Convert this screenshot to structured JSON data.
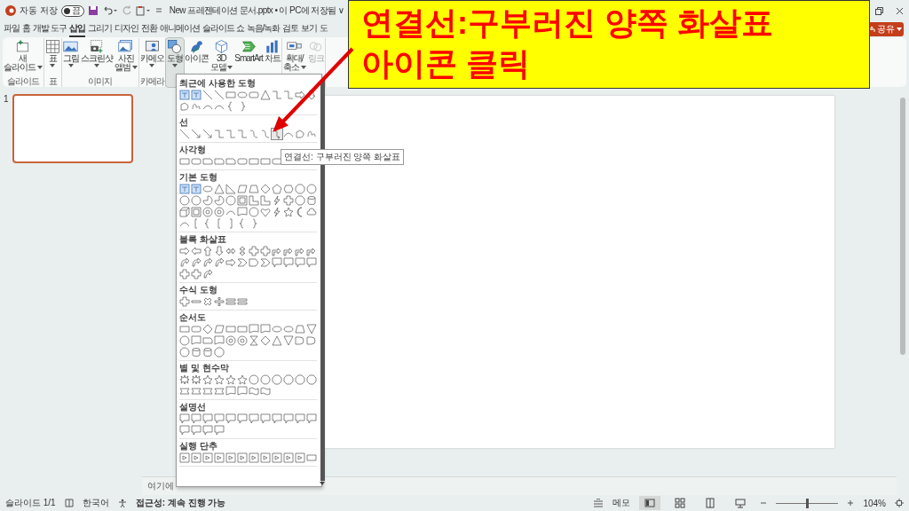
{
  "title_bar": {
    "autosave_label": "자동 저장",
    "autosave": {
      "on": false,
      "text": "끔"
    },
    "document_title": "New 프레젠테이션 문서.pptx • 이 PC에 저장됨 ∨"
  },
  "tabs": [
    {
      "label": "파일",
      "selected": false
    },
    {
      "label": "홈",
      "selected": false
    },
    {
      "label": "개발 도구",
      "selected": false
    },
    {
      "label": "삽입",
      "selected": true
    },
    {
      "label": "그리기",
      "selected": false
    },
    {
      "label": "디자인",
      "selected": false
    },
    {
      "label": "전환",
      "selected": false
    },
    {
      "label": "애니메이션",
      "selected": false
    },
    {
      "label": "슬라이드 쇼",
      "selected": false
    },
    {
      "label": "녹음/녹화",
      "selected": false
    },
    {
      "label": "검토",
      "selected": false
    },
    {
      "label": "보기",
      "selected": false
    },
    {
      "label": "도",
      "selected": false
    }
  ],
  "share_button": "공유",
  "ribbon": {
    "groups": [
      {
        "label": "슬라이드",
        "items": [
          {
            "label": "새\n슬라이드",
            "dropdown": true,
            "selected": false,
            "disabled": false
          }
        ]
      },
      {
        "label": "표",
        "items": [
          {
            "label": "표",
            "dropdown": true,
            "selected": false,
            "disabled": false
          }
        ]
      },
      {
        "label": "이미지",
        "items": [
          {
            "label": "그림",
            "dropdown": true,
            "selected": false,
            "disabled": false
          },
          {
            "label": "스크린샷",
            "dropdown": true,
            "selected": false,
            "disabled": false
          },
          {
            "label": "사진\n앨범",
            "dropdown": true,
            "selected": false,
            "disabled": false
          }
        ]
      },
      {
        "label": "카메라",
        "items": [
          {
            "label": "카메오",
            "dropdown": true,
            "selected": false,
            "disabled": false
          }
        ]
      },
      {
        "items": [
          {
            "label": "도형",
            "dropdown": true,
            "selected": true,
            "disabled": false
          },
          {
            "label": "아이콘",
            "dropdown": false,
            "selected": false,
            "disabled": false
          },
          {
            "label": "3D\n모델",
            "dropdown": true,
            "selected": false,
            "disabled": false
          },
          {
            "label": "SmartArt",
            "dropdown": false,
            "selected": false,
            "disabled": false
          },
          {
            "label": "차트",
            "dropdown": false,
            "selected": false,
            "disabled": false
          }
        ]
      },
      {
        "items": [
          {
            "label": "확대/\n축소",
            "dropdown": true,
            "selected": false,
            "disabled": false
          },
          {
            "label": "링크",
            "dropdown": false,
            "selected": false,
            "disabled": true
          }
        ]
      }
    ]
  },
  "shapes_menu": {
    "sections": [
      {
        "heading": "최근에 사용한 도형",
        "shapes": [
          {
            "kind": "textbox"
          },
          {
            "kind": "textbox"
          },
          {
            "kind": "line"
          },
          {
            "kind": "line"
          },
          {
            "kind": "rect"
          },
          {
            "kind": "oval"
          },
          {
            "kind": "roundrect"
          },
          {
            "kind": "triangle"
          },
          {
            "kind": "elbow"
          },
          {
            "kind": "elbow"
          },
          {
            "kind": "arrow-right"
          },
          {
            "kind": "arrow-down"
          },
          {
            "kind": "freeform"
          },
          {
            "kind": "scribble"
          },
          {
            "kind": "arc"
          },
          {
            "kind": "arc"
          },
          {
            "kind": "brace-left"
          },
          {
            "kind": "brace-right"
          }
        ]
      },
      {
        "heading": "선",
        "shapes": [
          {
            "kind": "line",
            "selected": false
          },
          {
            "kind": "arrow-line",
            "selected": false
          },
          {
            "kind": "arrow-line",
            "selected": false
          },
          {
            "kind": "elbow",
            "selected": false
          },
          {
            "kind": "elbow",
            "selected": false
          },
          {
            "kind": "elbow",
            "selected": false
          },
          {
            "kind": "curve",
            "selected": false
          },
          {
            "kind": "curve",
            "selected": false
          },
          {
            "kind": "curved-double-arrow",
            "selected": true
          },
          {
            "kind": "arc",
            "selected": false
          },
          {
            "kind": "freeform",
            "selected": false
          },
          {
            "kind": "scribble",
            "selected": false
          }
        ]
      },
      {
        "heading": "사각형",
        "shapes": [
          {
            "kind": "rect"
          },
          {
            "kind": "roundrect"
          },
          {
            "kind": "snip"
          },
          {
            "kind": "snip"
          },
          {
            "kind": "snip"
          },
          {
            "kind": "roundrect"
          },
          {
            "kind": "rect"
          },
          {
            "kind": "rect"
          },
          {
            "kind": "roundrect"
          }
        ]
      },
      {
        "heading": "기본 도형",
        "shapes": [
          {
            "kind": "textbox"
          },
          {
            "kind": "textbox"
          },
          {
            "kind": "oval"
          },
          {
            "kind": "triangle"
          },
          {
            "kind": "rtriangle"
          },
          {
            "kind": "parallelogram"
          },
          {
            "kind": "trapezoid"
          },
          {
            "kind": "diamond"
          },
          {
            "kind": "pentagon"
          },
          {
            "kind": "hexagon"
          },
          {
            "kind": "octagon"
          },
          {
            "kind": "circle"
          },
          {
            "kind": "circle"
          },
          {
            "kind": "circle"
          },
          {
            "kind": "pie"
          },
          {
            "kind": "pie"
          },
          {
            "kind": "circle"
          },
          {
            "kind": "frame"
          },
          {
            "kind": "lshape"
          },
          {
            "kind": "lshape"
          },
          {
            "kind": "lightning"
          },
          {
            "kind": "plus"
          },
          {
            "kind": "octagon"
          },
          {
            "kind": "can"
          },
          {
            "kind": "cube"
          },
          {
            "kind": "frame"
          },
          {
            "kind": "donut"
          },
          {
            "kind": "donut"
          },
          {
            "kind": "arc"
          },
          {
            "kind": "document"
          },
          {
            "kind": "circle"
          },
          {
            "kind": "heart"
          },
          {
            "kind": "lightning"
          },
          {
            "kind": "star"
          },
          {
            "kind": "moon"
          },
          {
            "kind": "cloud"
          },
          {
            "kind": "arc"
          },
          {
            "kind": "bracket-left"
          },
          {
            "kind": "brace-left"
          },
          {
            "kind": "bracket-left"
          },
          {
            "kind": "bracket-right"
          },
          {
            "kind": "brace-left"
          },
          {
            "kind": "brace-right"
          }
        ]
      },
      {
        "heading": "블록 화살표",
        "shapes": [
          {
            "kind": "arrow-right"
          },
          {
            "kind": "arrow-left"
          },
          {
            "kind": "arrow-up"
          },
          {
            "kind": "arrow-down"
          },
          {
            "kind": "arrow-lr"
          },
          {
            "kind": "arrow-ud"
          },
          {
            "kind": "plus"
          },
          {
            "kind": "plus"
          },
          {
            "kind": "arrow-bent"
          },
          {
            "kind": "arrow-bent"
          },
          {
            "kind": "arrow-bent"
          },
          {
            "kind": "arrow-bent"
          },
          {
            "kind": "arrow-curved"
          },
          {
            "kind": "arrow-curved"
          },
          {
            "kind": "arrow-curved"
          },
          {
            "kind": "arrow-curved"
          },
          {
            "kind": "arrow-right"
          },
          {
            "kind": "chevron"
          },
          {
            "kind": "pentagon-arrow"
          },
          {
            "kind": "chevron"
          },
          {
            "kind": "callout"
          },
          {
            "kind": "callout"
          },
          {
            "kind": "callout"
          },
          {
            "kind": "callout"
          },
          {
            "kind": "plus"
          },
          {
            "kind": "plus"
          },
          {
            "kind": "arrow-curved"
          }
        ]
      },
      {
        "heading": "수식 도형",
        "shapes": [
          {
            "kind": "plus"
          },
          {
            "kind": "minus"
          },
          {
            "kind": "times"
          },
          {
            "kind": "divide"
          },
          {
            "kind": "equal"
          },
          {
            "kind": "equal"
          }
        ]
      },
      {
        "heading": "순서도",
        "shapes": [
          {
            "kind": "rect"
          },
          {
            "kind": "roundrect"
          },
          {
            "kind": "diamond"
          },
          {
            "kind": "parallelogram"
          },
          {
            "kind": "rect"
          },
          {
            "kind": "rect"
          },
          {
            "kind": "document"
          },
          {
            "kind": "document"
          },
          {
            "kind": "oval"
          },
          {
            "kind": "oval"
          },
          {
            "kind": "trapezoid"
          },
          {
            "kind": "triangle-down"
          },
          {
            "kind": "circle"
          },
          {
            "kind": "document"
          },
          {
            "kind": "snip"
          },
          {
            "kind": "document"
          },
          {
            "kind": "donut"
          },
          {
            "kind": "donut"
          },
          {
            "kind": "hourglass"
          },
          {
            "kind": "diamond"
          },
          {
            "kind": "triangle"
          },
          {
            "kind": "triangle-down"
          },
          {
            "kind": "delay"
          },
          {
            "kind": "delay"
          },
          {
            "kind": "circle"
          },
          {
            "kind": "can"
          },
          {
            "kind": "can"
          },
          {
            "kind": "octagon"
          }
        ]
      },
      {
        "heading": "별 및 현수막",
        "shapes": [
          {
            "kind": "burst"
          },
          {
            "kind": "burst"
          },
          {
            "kind": "star"
          },
          {
            "kind": "star"
          },
          {
            "kind": "star"
          },
          {
            "kind": "star"
          },
          {
            "kind": "circle"
          },
          {
            "kind": "circle"
          },
          {
            "kind": "octagon"
          },
          {
            "kind": "octagon"
          },
          {
            "kind": "octagon"
          },
          {
            "kind": "octagon"
          },
          {
            "kind": "banner"
          },
          {
            "kind": "banner"
          },
          {
            "kind": "banner"
          },
          {
            "kind": "banner"
          },
          {
            "kind": "document"
          },
          {
            "kind": "document"
          },
          {
            "kind": "wave"
          },
          {
            "kind": "wave"
          }
        ]
      },
      {
        "heading": "설명선",
        "shapes": [
          {
            "kind": "callout"
          },
          {
            "kind": "callout"
          },
          {
            "kind": "callout"
          },
          {
            "kind": "callout"
          },
          {
            "kind": "callout"
          },
          {
            "kind": "callout"
          },
          {
            "kind": "callout"
          },
          {
            "kind": "callout"
          },
          {
            "kind": "callout"
          },
          {
            "kind": "callout"
          },
          {
            "kind": "callout"
          },
          {
            "kind": "callout"
          },
          {
            "kind": "callout"
          },
          {
            "kind": "callout"
          },
          {
            "kind": "callout"
          },
          {
            "kind": "callout"
          }
        ]
      },
      {
        "heading": "실행 단추",
        "shapes": [
          {
            "kind": "button"
          },
          {
            "kind": "button"
          },
          {
            "kind": "button"
          },
          {
            "kind": "button"
          },
          {
            "kind": "button"
          },
          {
            "kind": "button"
          },
          {
            "kind": "button"
          },
          {
            "kind": "button"
          },
          {
            "kind": "button"
          },
          {
            "kind": "button"
          },
          {
            "kind": "button"
          },
          {
            "kind": "rect"
          }
        ]
      }
    ]
  },
  "tooltip": "연결선: 구부러진 양쪽 화살표",
  "callout": {
    "lines": [
      "연결선:구부러진 양쪽 화살표",
      "아이콘 클릭"
    ]
  },
  "slide_panel": {
    "slides": [
      {
        "number": "1",
        "selected": true
      }
    ]
  },
  "notes_placeholder": "여기에",
  "status_bar": {
    "slide_counter": "슬라이드 1/1",
    "language": "한국어",
    "accessibility": "접근성: 계속 진행 가능",
    "notes_button": "메모",
    "views": [
      {
        "selected": true
      },
      {
        "selected": false
      },
      {
        "selected": false
      },
      {
        "selected": false
      }
    ],
    "zoom": {
      "level": 0.5,
      "reading": "104%"
    }
  }
}
